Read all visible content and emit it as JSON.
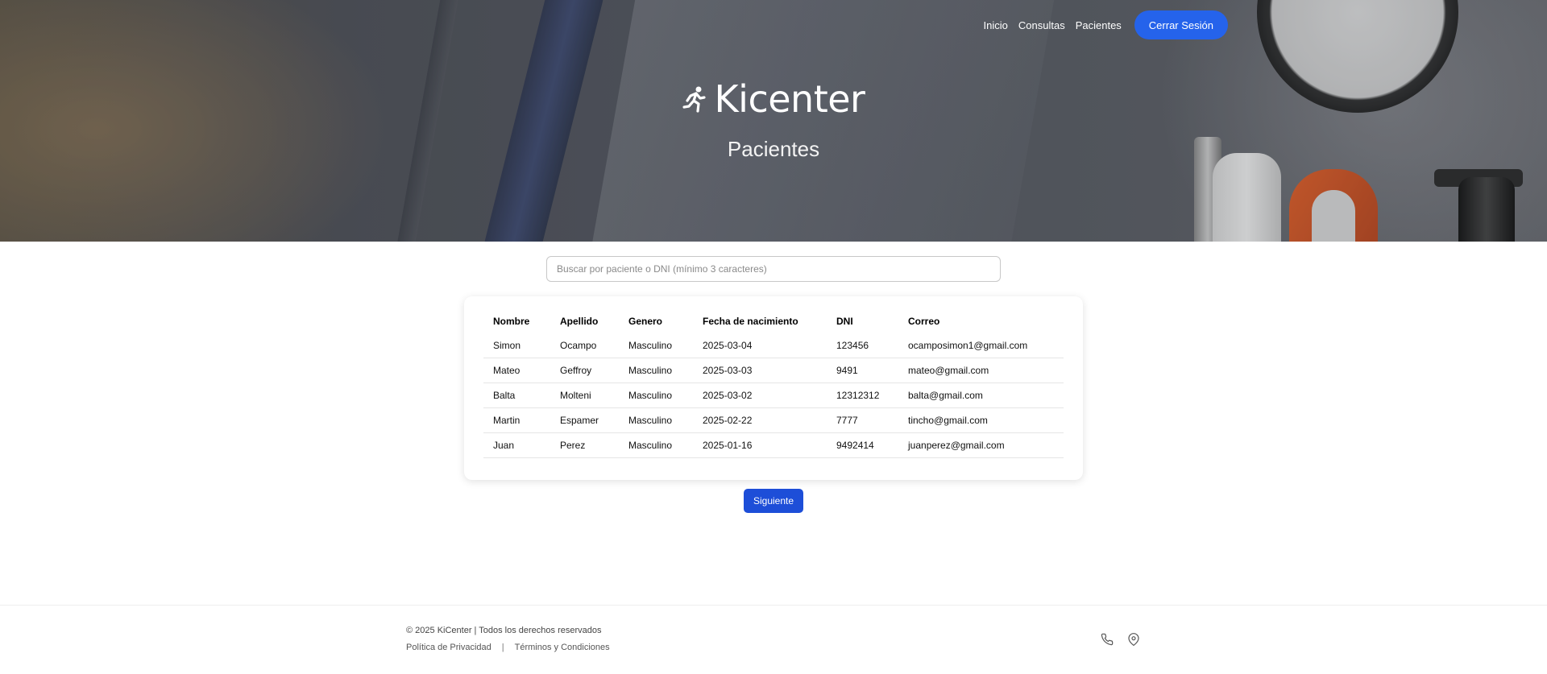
{
  "nav": {
    "items": [
      {
        "label": "Inicio"
      },
      {
        "label": "Consultas"
      },
      {
        "label": "Pacientes"
      }
    ],
    "logout_label": "Cerrar Sesión",
    "accent": "#2563eb"
  },
  "hero": {
    "brand": "Kicenter",
    "brand_icon": "running-person-icon",
    "heading": "Pacientes"
  },
  "search": {
    "placeholder": "Buscar por paciente o DNI (mínimo 3 caracteres)",
    "value": ""
  },
  "table": {
    "headers": [
      "Nombre",
      "Apellido",
      "Genero",
      "Fecha de nacimiento",
      "DNI",
      "Correo"
    ],
    "rows": [
      [
        "Simon",
        "Ocampo",
        "Masculino",
        "2025-03-04",
        "123456",
        "ocamposimon1@gmail.com"
      ],
      [
        "Mateo",
        "Geffroy",
        "Masculino",
        "2025-03-03",
        "9491",
        "mateo@gmail.com"
      ],
      [
        "Balta",
        "Molteni",
        "Masculino",
        "2025-03-02",
        "12312312",
        "balta@gmail.com"
      ],
      [
        "Martin",
        "Espamer",
        "Masculino",
        "2025-02-22",
        "7777",
        "tincho@gmail.com"
      ],
      [
        "Juan",
        "Perez",
        "Masculino",
        "2025-01-16",
        "9492414",
        "juanperez@gmail.com"
      ]
    ]
  },
  "pagination": {
    "next_label": "Siguiente",
    "button_color": "#1d4ed8"
  },
  "footer": {
    "copyright": "© 2025 KiCenter | Todos los derechos reservados",
    "privacy": "Política de Privacidad",
    "separator": "|",
    "terms": "Términos y Condiciones",
    "icons": [
      "phone-icon",
      "location-pin-icon"
    ]
  }
}
